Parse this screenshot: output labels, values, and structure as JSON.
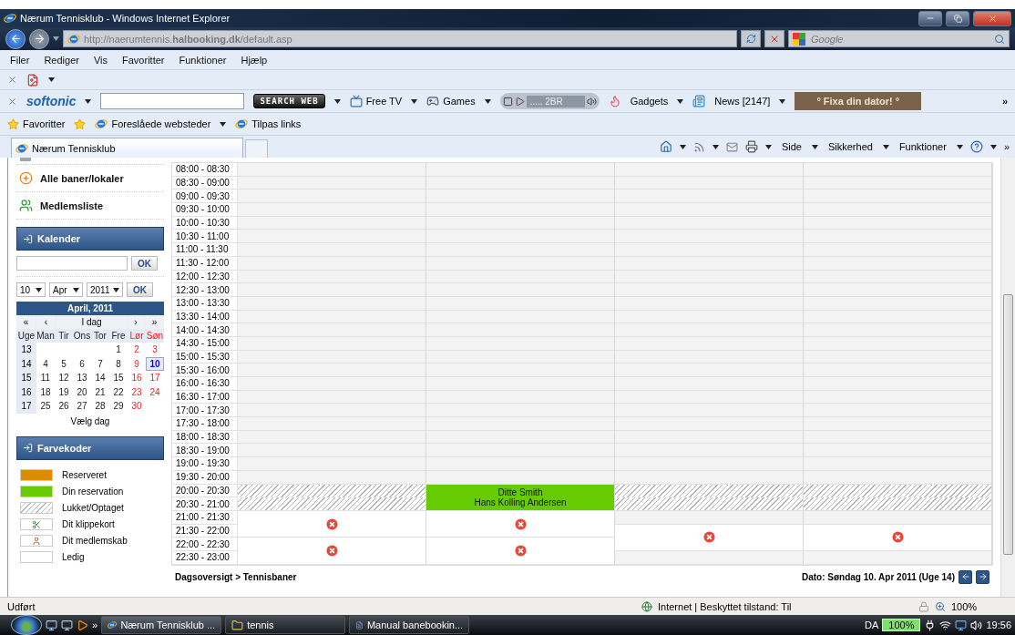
{
  "browser": {
    "title": "Nærum Tennisklub - Windows Internet Explorer",
    "url": "http://naerumtennis.**halbooking.dk**/default.asp",
    "search_placeholder": "Google",
    "menu": [
      "Filer",
      "Rediger",
      "Vis",
      "Favoritter",
      "Funktioner",
      "Hjælp"
    ],
    "toolbar": {
      "brand": "softonic",
      "search_button": "SEARCH WEB",
      "links": [
        {
          "label": "Free TV",
          "kind": "tv"
        },
        {
          "label": "Games",
          "kind": "games"
        }
      ],
      "player": "..... 2BR",
      "gadgets": "Gadgets",
      "news": "News [2147]",
      "promo": "° Fixa din dator! °",
      "more": "»"
    },
    "favorites": {
      "label": "Favoritter",
      "links": [
        "Foreslåede websteder",
        "Tilpas links"
      ]
    },
    "tab": "Nærum Tennisklub",
    "commands": [
      "Side",
      "Sikkerhed",
      "Funktioner"
    ],
    "commands_more": "»"
  },
  "sidebar": {
    "links": [
      {
        "label": "Alle baner/lokaler",
        "kind": "add"
      },
      {
        "label": "Medlemsliste",
        "kind": "members"
      }
    ],
    "calendar_panel": {
      "title": "Kalender",
      "ok": "OK",
      "selects": [
        "10",
        "Apr",
        "2011"
      ],
      "select_ok": "OK"
    },
    "calendar": {
      "title": "April, 2011",
      "nav": [
        "«",
        "‹",
        "I dag",
        "›",
        "»"
      ],
      "weekdays": [
        {
          "label": "Uge",
          "kind": "week"
        },
        {
          "label": "Man",
          "kind": "weekday"
        },
        {
          "label": "Tir",
          "kind": "weekday"
        },
        {
          "label": "Ons",
          "kind": "weekday"
        },
        {
          "label": "Tor",
          "kind": "weekday"
        },
        {
          "label": "Fre",
          "kind": "weekday"
        },
        {
          "label": "Lør",
          "kind": "weekend"
        },
        {
          "label": "Søn",
          "kind": "weekend"
        }
      ],
      "weeks": [
        {
          "number": "13",
          "days": [
            {
              "kind": "blank"
            },
            {
              "kind": "blank"
            },
            {
              "kind": "blank"
            },
            {
              "kind": "blank"
            },
            {
              "label": "1",
              "kind": "weekday",
              "selected": false
            },
            {
              "label": "2",
              "kind": "weekend",
              "selected": false
            },
            {
              "label": "3",
              "kind": "weekend",
              "selected": false
            }
          ]
        },
        {
          "number": "14",
          "days": [
            {
              "label": "4",
              "kind": "weekday",
              "selected": false
            },
            {
              "label": "5",
              "kind": "weekday",
              "selected": false
            },
            {
              "label": "6",
              "kind": "weekday",
              "selected": false
            },
            {
              "label": "7",
              "kind": "weekday",
              "selected": false
            },
            {
              "label": "8",
              "kind": "weekday",
              "selected": false
            },
            {
              "label": "9",
              "kind": "weekend",
              "selected": false
            },
            {
              "label": "10",
              "kind": "weekend",
              "selected": true
            }
          ]
        },
        {
          "number": "15",
          "days": [
            {
              "label": "11",
              "kind": "weekday",
              "selected": false
            },
            {
              "label": "12",
              "kind": "weekday",
              "selected": false
            },
            {
              "label": "13",
              "kind": "weekday",
              "selected": false
            },
            {
              "label": "14",
              "kind": "weekday",
              "selected": false
            },
            {
              "label": "15",
              "kind": "weekday",
              "selected": false
            },
            {
              "label": "16",
              "kind": "weekend",
              "selected": false
            },
            {
              "label": "17",
              "kind": "weekend",
              "selected": false
            }
          ]
        },
        {
          "number": "16",
          "days": [
            {
              "label": "18",
              "kind": "weekday",
              "selected": false
            },
            {
              "label": "19",
              "kind": "weekday",
              "selected": false
            },
            {
              "label": "20",
              "kind": "weekday",
              "selected": false
            },
            {
              "label": "21",
              "kind": "weekday",
              "selected": false
            },
            {
              "label": "22",
              "kind": "weekday",
              "selected": false
            },
            {
              "label": "23",
              "kind": "weekend",
              "selected": false
            },
            {
              "label": "24",
              "kind": "weekend",
              "selected": false
            }
          ]
        },
        {
          "number": "17",
          "days": [
            {
              "label": "25",
              "kind": "weekday",
              "selected": false
            },
            {
              "label": "26",
              "kind": "weekday",
              "selected": false
            },
            {
              "label": "27",
              "kind": "weekday",
              "selected": false
            },
            {
              "label": "28",
              "kind": "weekday",
              "selected": false
            },
            {
              "label": "29",
              "kind": "weekday",
              "selected": false
            },
            {
              "label": "30",
              "kind": "weekend",
              "selected": false
            },
            {
              "kind": "blank"
            }
          ]
        }
      ],
      "footer": "Vælg dag"
    },
    "legend": {
      "title": "Farvekoder",
      "items": [
        {
          "label": "Reserveret",
          "kind": "reserved"
        },
        {
          "label": "Din reservation",
          "kind": "own"
        },
        {
          "label": "Lukket/Optaget",
          "kind": "closed"
        },
        {
          "label": "Dit klippekort",
          "kind": "punchcard"
        },
        {
          "label": "Dit medlemskab",
          "kind": "membership"
        },
        {
          "label": "Ledig",
          "kind": "free"
        }
      ]
    }
  },
  "schedule": {
    "rows": [
      {
        "time": "08:00 - 08:30",
        "cells": [
          {
            "kind": "open"
          },
          {
            "kind": "open"
          },
          {
            "kind": "open"
          },
          {
            "kind": "open"
          }
        ]
      },
      {
        "time": "08:30 - 09:00",
        "cells": [
          {
            "kind": "open"
          },
          {
            "kind": "open"
          },
          {
            "kind": "open"
          },
          {
            "kind": "open"
          }
        ]
      },
      {
        "time": "09:00 - 09:30",
        "cells": [
          {
            "kind": "open"
          },
          {
            "kind": "open"
          },
          {
            "kind": "open"
          },
          {
            "kind": "open"
          }
        ]
      },
      {
        "time": "09:30 - 10:00",
        "cells": [
          {
            "kind": "open"
          },
          {
            "kind": "open"
          },
          {
            "kind": "open"
          },
          {
            "kind": "open"
          }
        ]
      },
      {
        "time": "10:00 - 10:30",
        "cells": [
          {
            "kind": "open"
          },
          {
            "kind": "open"
          },
          {
            "kind": "open"
          },
          {
            "kind": "open"
          }
        ]
      },
      {
        "time": "10:30 - 11:00",
        "cells": [
          {
            "kind": "open"
          },
          {
            "kind": "open"
          },
          {
            "kind": "open"
          },
          {
            "kind": "open"
          }
        ]
      },
      {
        "time": "11:00 - 11:30",
        "cells": [
          {
            "kind": "open"
          },
          {
            "kind": "open"
          },
          {
            "kind": "open"
          },
          {
            "kind": "open"
          }
        ]
      },
      {
        "time": "11:30 - 12:00",
        "cells": [
          {
            "kind": "open"
          },
          {
            "kind": "open"
          },
          {
            "kind": "open"
          },
          {
            "kind": "open"
          }
        ]
      },
      {
        "time": "12:00 - 12:30",
        "cells": [
          {
            "kind": "open"
          },
          {
            "kind": "open"
          },
          {
            "kind": "open"
          },
          {
            "kind": "open"
          }
        ]
      },
      {
        "time": "12:30 - 13:00",
        "cells": [
          {
            "kind": "open"
          },
          {
            "kind": "open"
          },
          {
            "kind": "open"
          },
          {
            "kind": "open"
          }
        ]
      },
      {
        "time": "13:00 - 13:30",
        "cells": [
          {
            "kind": "open"
          },
          {
            "kind": "open"
          },
          {
            "kind": "open"
          },
          {
            "kind": "open"
          }
        ]
      },
      {
        "time": "13:30 - 14:00",
        "cells": [
          {
            "kind": "open"
          },
          {
            "kind": "open"
          },
          {
            "kind": "open"
          },
          {
            "kind": "open"
          }
        ]
      },
      {
        "time": "14:00 - 14:30",
        "cells": [
          {
            "kind": "open"
          },
          {
            "kind": "open"
          },
          {
            "kind": "open"
          },
          {
            "kind": "open"
          }
        ]
      },
      {
        "time": "14:30 - 15:00",
        "cells": [
          {
            "kind": "open"
          },
          {
            "kind": "open"
          },
          {
            "kind": "open"
          },
          {
            "kind": "open"
          }
        ]
      },
      {
        "time": "15:00 - 15:30",
        "cells": [
          {
            "kind": "open"
          },
          {
            "kind": "open"
          },
          {
            "kind": "open"
          },
          {
            "kind": "open"
          }
        ]
      },
      {
        "time": "15:30 - 16:00",
        "cells": [
          {
            "kind": "open"
          },
          {
            "kind": "open"
          },
          {
            "kind": "open"
          },
          {
            "kind": "open"
          }
        ]
      },
      {
        "time": "16:00 - 16:30",
        "cells": [
          {
            "kind": "open"
          },
          {
            "kind": "open"
          },
          {
            "kind": "open"
          },
          {
            "kind": "open"
          }
        ]
      },
      {
        "time": "16:30 - 17:00",
        "cells": [
          {
            "kind": "open"
          },
          {
            "kind": "open"
          },
          {
            "kind": "open"
          },
          {
            "kind": "open"
          }
        ]
      },
      {
        "time": "17:00 - 17:30",
        "cells": [
          {
            "kind": "open"
          },
          {
            "kind": "open"
          },
          {
            "kind": "open"
          },
          {
            "kind": "open"
          }
        ]
      },
      {
        "time": "17:30 - 18:00",
        "cells": [
          {
            "kind": "open"
          },
          {
            "kind": "open"
          },
          {
            "kind": "open"
          },
          {
            "kind": "open"
          }
        ]
      },
      {
        "time": "18:00 - 18:30",
        "cells": [
          {
            "kind": "open"
          },
          {
            "kind": "open"
          },
          {
            "kind": "open"
          },
          {
            "kind": "open"
          }
        ]
      },
      {
        "time": "18:30 - 19:00",
        "cells": [
          {
            "kind": "open"
          },
          {
            "kind": "open"
          },
          {
            "kind": "open"
          },
          {
            "kind": "open"
          }
        ]
      },
      {
        "time": "19:00 - 19:30",
        "cells": [
          {
            "kind": "open"
          },
          {
            "kind": "open"
          },
          {
            "kind": "open"
          },
          {
            "kind": "open"
          }
        ]
      },
      {
        "time": "19:30 - 20:00",
        "cells": [
          {
            "kind": "open"
          },
          {
            "kind": "open"
          },
          {
            "kind": "open"
          },
          {
            "kind": "open"
          }
        ]
      },
      {
        "time": "20:00 - 20:30",
        "cells": [
          {
            "kind": "closed"
          },
          {
            "kind": "booked",
            "names": [
              "Ditte Smith",
              "Hans Kolling Andersen"
            ]
          },
          {
            "kind": "closed"
          },
          {
            "kind": "closed"
          }
        ]
      },
      {
        "time": "20:30 - 21:00",
        "cells": [
          {
            "kind": "closed",
            "joined": true
          },
          {
            "kind": "booked",
            "joined": true
          },
          {
            "kind": "closed",
            "joined": true
          },
          {
            "kind": "closed",
            "joined": true
          }
        ]
      },
      {
        "time": "21:00 - 21:30",
        "cells": [
          {
            "kind": "free",
            "cancel": true
          },
          {
            "kind": "free",
            "cancel": true
          },
          {
            "kind": "open"
          },
          {
            "kind": "open"
          }
        ]
      },
      {
        "time": "21:30 - 22:00",
        "cells": [
          {
            "kind": "free",
            "joined": true
          },
          {
            "kind": "free",
            "joined": true
          },
          {
            "kind": "free",
            "cancel": true
          },
          {
            "kind": "free",
            "cancel": true
          }
        ]
      },
      {
        "time": "22:00 - 22:30",
        "cells": [
          {
            "kind": "free",
            "cancel": true
          },
          {
            "kind": "free",
            "cancel": true
          },
          {
            "kind": "free",
            "joined": true
          },
          {
            "kind": "free",
            "joined": true
          }
        ]
      },
      {
        "time": "22:30 - 23:00",
        "cells": [
          {
            "kind": "free",
            "joined": true
          },
          {
            "kind": "free",
            "joined": true
          },
          {
            "kind": "open"
          },
          {
            "kind": "open"
          }
        ]
      }
    ],
    "breadcrumb": "Dagsoversigt > Tennisbaner",
    "date": "Dato: Søndag 10. Apr 2011 (Uge 14)"
  },
  "status": {
    "text": "Udført",
    "zone": "Internet | Beskyttet tilstand: Til",
    "zoom": "100%"
  },
  "taskbar": {
    "more": "»",
    "tasks": [
      {
        "label": "Nærum Tennisklub ...",
        "kind": "browser",
        "selected": true
      },
      {
        "label": "tennis",
        "kind": "folder",
        "selected": false
      },
      {
        "label": "Manual banebookin...",
        "kind": "document",
        "selected": false
      }
    ],
    "language": "DA",
    "battery": "100%",
    "clock": "19:56"
  }
}
